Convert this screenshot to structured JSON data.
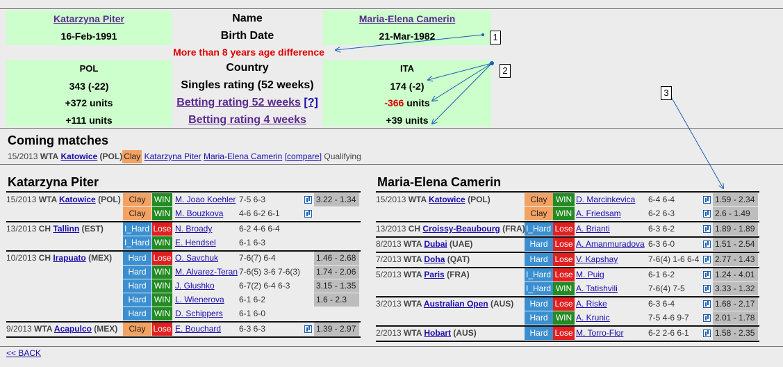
{
  "compare": {
    "player1": {
      "name": "Katarzyna Piter",
      "birth": "16-Feb-1991",
      "country": "POL",
      "rating": "343 (-22)",
      "bet52": "+372 units",
      "bet4": "+111 units"
    },
    "player2": {
      "name": "Maria-Elena Camerin",
      "birth": "21-Mar-1982",
      "country": "ITA",
      "rating": "174 (-2)",
      "bet52_value": "-366",
      "bet52_units": "units",
      "bet4": "+39 units"
    },
    "labels": {
      "name": "Name",
      "birth": "Birth Date",
      "age_diff": "More than 8 years age difference",
      "country": "Country",
      "rating": "Singles rating (52 weeks)",
      "bet52": "Betting rating 52 weeks",
      "bet52_help": "[?]",
      "bet4": "Betting rating 4 weeks"
    }
  },
  "coming": {
    "title": "Coming matches",
    "week": "15/2013",
    "tour": "WTA",
    "city": "Katowice",
    "country": "(POL)",
    "surface": "Clay",
    "p1": "Katarzyna Piter",
    "p2": "Maria-Elena Camerin",
    "compare": "[compare]",
    "round": "Qualifying"
  },
  "markers": [
    "1",
    "2",
    "3"
  ],
  "left": {
    "title": "Katarzyna Piter",
    "events": [
      {
        "week": "15/2013",
        "tour": "WTA",
        "city": "Katowice",
        "country": "(POL)",
        "rows": [
          {
            "surface": "Clay",
            "result": "WIN",
            "opp": "M. Joao Koehler",
            "score": "7-5 6-3",
            "odds": "3.22 - 1.34"
          },
          {
            "surface": "Clay",
            "result": "WIN",
            "opp": "M. Bouzkova",
            "score": "4-6 6-2 6-1",
            "odds": ""
          }
        ]
      },
      {
        "week": "13/2013",
        "tour": "CH",
        "city": "Tallinn",
        "country": "(EST)",
        "rows": [
          {
            "surface": "I_Hard",
            "result": "Lose",
            "opp": "N. Broady",
            "score": "6-2 4-6 6-4",
            "odds": ""
          },
          {
            "surface": "I_Hard",
            "result": "WIN",
            "opp": "E. Hendsel",
            "score": "6-1 6-3",
            "odds": ""
          }
        ]
      },
      {
        "week": "10/2013",
        "tour": "CH",
        "city": "Irapuato",
        "country": "(MEX)",
        "rows": [
          {
            "surface": "Hard",
            "result": "Lose",
            "opp": "O. Savchuk",
            "score": "7-6(7) 6-4",
            "odds": "1.46 - 2.68"
          },
          {
            "surface": "Hard",
            "result": "WIN",
            "opp": "M. Alvarez-Teran",
            "score": "7-6(5) 3-6 7-6(3)",
            "odds": "1.74 - 2.06"
          },
          {
            "surface": "Hard",
            "result": "WIN",
            "opp": "J. Glushko",
            "score": "6-7(2) 6-4 6-3",
            "odds": "3.15 - 1.35"
          },
          {
            "surface": "Hard",
            "result": "WIN",
            "opp": "L. Wienerova",
            "score": "6-1 6-2",
            "odds": "1.6 - 2.3"
          },
          {
            "surface": "Hard",
            "result": "WIN",
            "opp": "D. Schippers",
            "score": "6-1 6-0",
            "odds": ""
          }
        ]
      },
      {
        "week": "9/2013",
        "tour": "WTA",
        "city": "Acapulco",
        "country": "(MEX)",
        "rows": [
          {
            "surface": "Clay",
            "result": "Lose",
            "opp": "E. Bouchard",
            "score": "6-3 6-3",
            "odds": "1.39 - 2.97"
          }
        ]
      }
    ]
  },
  "right": {
    "title": "Maria-Elena Camerin",
    "events": [
      {
        "week": "15/2013",
        "tour": "WTA",
        "city": "Katowice",
        "country": "(POL)",
        "rows": [
          {
            "surface": "Clay",
            "result": "WIN",
            "opp": "D. Marcinkevica",
            "score": "6-4 6-4",
            "odds": "1.59 - 2.34"
          },
          {
            "surface": "Clay",
            "result": "WIN",
            "opp": "A. Friedsam",
            "score": "6-2 6-3",
            "odds": "2.6  - 1.49"
          }
        ]
      },
      {
        "week": "13/2013",
        "tour": "CH",
        "city": "Croissy-Beaubourg",
        "country": "(FRA)",
        "rows": [
          {
            "surface": "I_Hard",
            "result": "Lose",
            "opp": "A. Brianti",
            "score": "6-3 6-2",
            "odds": "1.89 - 1.89"
          }
        ]
      },
      {
        "week": "8/2013",
        "tour": "WTA",
        "city": "Dubai",
        "country": "(UAE)",
        "rows": [
          {
            "surface": "Hard",
            "result": "Lose",
            "opp": "A. Amanmuradova",
            "score": "6-3 6-0",
            "odds": "1.51 - 2.54"
          }
        ]
      },
      {
        "week": "7/2013",
        "tour": "WTA",
        "city": "Doha",
        "country": "(QAT)",
        "rows": [
          {
            "surface": "Hard",
            "result": "Lose",
            "opp": "V. Kapshay",
            "score": "7-6(4) 1-6 6-4",
            "odds": "2.77 - 1.43"
          }
        ]
      },
      {
        "week": "5/2013",
        "tour": "WTA",
        "city": "Paris",
        "country": "(FRA)",
        "rows": [
          {
            "surface": "I_Hard",
            "result": "Lose",
            "opp": "M. Puig",
            "score": "6-1 6-2",
            "odds": "1.24 - 4.01"
          },
          {
            "surface": "I_Hard",
            "result": "WIN",
            "opp": "A. Tatishvili",
            "score": "7-6(4) 7-5",
            "odds": "3.33 - 1.32"
          }
        ]
      },
      {
        "week": "3/2013",
        "tour": "WTA",
        "city": "Australian Open",
        "country": "(AUS)",
        "rows": [
          {
            "surface": "Hard",
            "result": "Lose",
            "opp": "A. Riske",
            "score": "6-3 6-4",
            "odds": "1.68 - 2.17"
          },
          {
            "surface": "Hard",
            "result": "WIN",
            "opp": "A. Krunic",
            "score": "7-5 4-6 9-7",
            "odds": "2.01 - 1.78"
          }
        ]
      },
      {
        "week": "2/2013",
        "tour": "WTA",
        "city": "Hobart",
        "country": "(AUS)",
        "rows": [
          {
            "surface": "Hard",
            "result": "Lose",
            "opp": "M. Torro-Flor",
            "score": "6-2 2-6 6-1",
            "odds": "1.58 - 2.35"
          }
        ]
      }
    ]
  },
  "footer": {
    "back": "<< BACK"
  }
}
